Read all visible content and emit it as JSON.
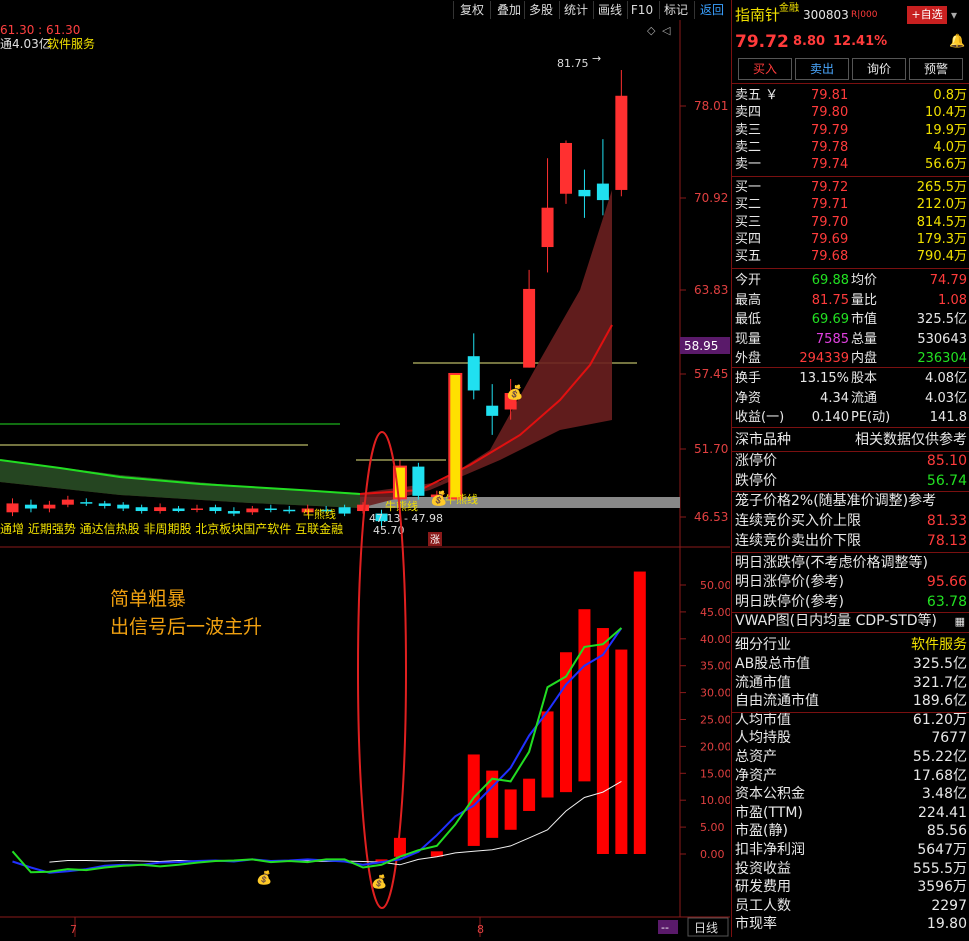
{
  "toolbar": {
    "buttons": [
      "复权",
      "叠加",
      "多股",
      "统计",
      "画线",
      "F10",
      "标记",
      "返回"
    ]
  },
  "chart_header": {
    "line1": "61.30 : 61.30",
    "line2_prefix": "通4.03亿",
    "line2_sector": "软件服务"
  },
  "price_axis": [
    "78.01",
    "70.92",
    "63.83",
    "57.45",
    "51.70",
    "46.53"
  ],
  "current_price_tag": "58.95",
  "high_annotation": "81.75",
  "low_annotation_range": "47.13 - 47.98",
  "low_annotation": "45.70",
  "bull_bear_labels": [
    "牛熊线",
    "牛熊线",
    "牛熊线"
  ],
  "concept_tags": "通增 近期强势 通达信热股 非周期股 北京板块国产软件 互联金融",
  "limit_badge": "涨",
  "annotation_text": [
    "简单粗暴",
    "出信号后一波主升"
  ],
  "indicator_axis": [
    "50.00",
    "45.00",
    "40.00",
    "35.00",
    "30.00",
    "25.00",
    "20.00",
    "15.00",
    "10.00",
    "5.00",
    "0.00"
  ],
  "time_axis": [
    "7",
    "8"
  ],
  "bottom_right": {
    "toggle": "--",
    "label": "日线"
  },
  "stock": {
    "name": "指南针",
    "badge": "金融",
    "code": "300803",
    "r_badge": "R|000",
    "add_button": "+自选",
    "price": "79.72",
    "change": "8.80",
    "change_pct": "12.41%"
  },
  "actions": [
    "买入",
    "卖出",
    "询价",
    "预警"
  ],
  "order_book": {
    "asks": [
      {
        "label": "卖五 ￥",
        "price": "79.81",
        "vol": "0.8万"
      },
      {
        "label": "卖四",
        "price": "79.80",
        "vol": "10.4万"
      },
      {
        "label": "卖三",
        "price": "79.79",
        "vol": "19.9万"
      },
      {
        "label": "卖二",
        "price": "79.78",
        "vol": "4.0万"
      },
      {
        "label": "卖一",
        "price": "79.74",
        "vol": "56.6万"
      }
    ],
    "bids": [
      {
        "label": "买一",
        "price": "79.72",
        "vol": "265.5万"
      },
      {
        "label": "买二",
        "price": "79.71",
        "vol": "212.0万"
      },
      {
        "label": "买三",
        "price": "79.70",
        "vol": "814.5万"
      },
      {
        "label": "买四",
        "price": "79.69",
        "vol": "179.3万"
      },
      {
        "label": "买五",
        "price": "79.68",
        "vol": "790.4万"
      }
    ]
  },
  "stats": [
    {
      "l1": "今开",
      "v1": "69.88",
      "c1": "green",
      "l2": "均价",
      "v2": "74.79",
      "c2": "red"
    },
    {
      "l1": "最高",
      "v1": "81.75",
      "c1": "red",
      "l2": "量比",
      "v2": "1.08",
      "c2": "red"
    },
    {
      "l1": "最低",
      "v1": "69.69",
      "c1": "green",
      "l2": "市值",
      "v2": "325.5亿",
      "c2": "white"
    },
    {
      "l1": "现量",
      "v1": "7585",
      "c1": "magenta",
      "l2": "总量",
      "v2": "530643",
      "c2": "white"
    },
    {
      "l1": "外盘",
      "v1": "294339",
      "c1": "red",
      "l2": "内盘",
      "v2": "236304",
      "c2": "green"
    }
  ],
  "stats2": [
    {
      "l1": "换手",
      "v1": "13.15%",
      "l2": "股本",
      "v2": "4.08亿"
    },
    {
      "l1": "净资",
      "v1": "4.34",
      "l2": "流通",
      "v2": "4.03亿"
    },
    {
      "l1": "收益(一)",
      "v1": "0.140",
      "l2": "PE(动)",
      "v2": "141.8"
    }
  ],
  "market": {
    "left": "深市品种",
    "right": "相关数据仅供参考"
  },
  "limits": [
    {
      "l": "涨停价",
      "v": "85.10",
      "c": "red"
    },
    {
      "l": "跌停价",
      "v": "56.74",
      "c": "green"
    }
  ],
  "cage_title": "笼子价格2%(随基准价调整)参考",
  "cage": [
    {
      "l": "连续竞价买入价上限",
      "v": "81.33"
    },
    {
      "l": "连续竞价卖出价下限",
      "v": "78.13"
    }
  ],
  "tomorrow_title": "明日涨跌停(不考虑价格调整等)",
  "tomorrow": [
    {
      "l": "明日涨停价(参考)",
      "v": "95.66",
      "c": "red"
    },
    {
      "l": "明日跌停价(参考)",
      "v": "63.78",
      "c": "green"
    }
  ],
  "vwap": "VWAP图(日内均量 CDP-STD等)",
  "industry": {
    "label": "细分行业",
    "value": "软件服务"
  },
  "fundamentals": [
    {
      "l": "AB股总市值",
      "v": "325.5亿"
    },
    {
      "l": "流通市值",
      "v": "321.7亿"
    },
    {
      "l": "自由流通市值",
      "v": "189.6亿"
    },
    {
      "l": "人均市值",
      "v": "61.20万"
    },
    {
      "l": "人均持股",
      "v": "7677"
    },
    {
      "l": "总资产",
      "v": "55.22亿"
    },
    {
      "l": "净资产",
      "v": "17.68亿"
    },
    {
      "l": "资本公积金",
      "v": "3.48亿"
    },
    {
      "l": "市盈(TTM)",
      "v": "224.41"
    },
    {
      "l": "市盈(静)",
      "v": "85.56"
    },
    {
      "l": "扣非净利润",
      "v": "5647万"
    },
    {
      "l": "投资收益",
      "v": "555.5万"
    },
    {
      "l": "研发费用",
      "v": "3596万"
    },
    {
      "l": "员工人数",
      "v": "2297"
    },
    {
      "l": "市现率",
      "v": "19.80"
    }
  ],
  "chart_data": {
    "type": "candlestick",
    "price_ylim": [
      46.53,
      81.75
    ],
    "candles": [
      {
        "o": 46.9,
        "c": 47.6,
        "h": 48.0,
        "l": 46.6
      },
      {
        "o": 47.5,
        "c": 47.2,
        "h": 47.9,
        "l": 46.9
      },
      {
        "o": 47.2,
        "c": 47.5,
        "h": 47.8,
        "l": 46.9
      },
      {
        "o": 47.5,
        "c": 47.9,
        "h": 48.2,
        "l": 47.3
      },
      {
        "o": 47.7,
        "c": 47.6,
        "h": 48.0,
        "l": 47.4
      },
      {
        "o": 47.6,
        "c": 47.4,
        "h": 47.8,
        "l": 47.2
      },
      {
        "o": 47.5,
        "c": 47.2,
        "h": 47.7,
        "l": 47.0
      },
      {
        "o": 47.3,
        "c": 47.0,
        "h": 47.5,
        "l": 46.8
      },
      {
        "o": 47.0,
        "c": 47.3,
        "h": 47.6,
        "l": 46.8
      },
      {
        "o": 47.2,
        "c": 47.0,
        "h": 47.4,
        "l": 46.9
      },
      {
        "o": 47.1,
        "c": 47.2,
        "h": 47.5,
        "l": 46.9
      },
      {
        "o": 47.3,
        "c": 47.0,
        "h": 47.5,
        "l": 46.8
      },
      {
        "o": 47.0,
        "c": 46.8,
        "h": 47.3,
        "l": 46.6
      },
      {
        "o": 46.9,
        "c": 47.2,
        "h": 47.4,
        "l": 46.7
      },
      {
        "o": 47.2,
        "c": 47.1,
        "h": 47.5,
        "l": 46.9
      },
      {
        "o": 47.1,
        "c": 47.0,
        "h": 47.4,
        "l": 46.8
      },
      {
        "o": 46.9,
        "c": 47.2,
        "h": 47.5,
        "l": 46.7
      },
      {
        "o": 47.1,
        "c": 47.0,
        "h": 47.4,
        "l": 46.8
      },
      {
        "o": 47.3,
        "c": 46.8,
        "h": 47.5,
        "l": 46.6
      },
      {
        "o": 47.0,
        "c": 47.5,
        "h": 47.7,
        "l": 46.8
      },
      {
        "o": 46.8,
        "c": 46.2,
        "h": 47.1,
        "l": 45.7
      },
      {
        "o": 48.0,
        "c": 50.5,
        "h": 51.0,
        "l": 47.8
      },
      {
        "o": 50.5,
        "c": 48.2,
        "h": 50.8,
        "l": 47.9
      },
      {
        "o": 48.1,
        "c": 48.3,
        "h": 48.6,
        "l": 47.9
      },
      {
        "o": 48.0,
        "c": 57.8,
        "h": 57.8,
        "l": 47.9
      },
      {
        "o": 59.2,
        "c": 56.5,
        "h": 61.0,
        "l": 55.8
      },
      {
        "o": 55.3,
        "c": 54.5,
        "h": 57.0,
        "l": 53.0
      },
      {
        "o": 55.0,
        "c": 56.3,
        "h": 57.4,
        "l": 54.2
      },
      {
        "o": 58.3,
        "c": 64.5,
        "h": 66.0,
        "l": 58.3
      },
      {
        "o": 67.8,
        "c": 70.9,
        "h": 74.8,
        "l": 65.8
      },
      {
        "o": 72.0,
        "c": 76.0,
        "h": 76.2,
        "l": 71.2
      },
      {
        "o": 72.3,
        "c": 71.8,
        "h": 73.9,
        "l": 70.1
      },
      {
        "o": 72.8,
        "c": 71.5,
        "h": 76.3,
        "l": 70.3
      },
      {
        "o": 72.3,
        "c": 79.72,
        "h": 81.75,
        "l": 71.8
      }
    ],
    "indicator_ylim": [
      -5,
      55
    ],
    "indicator_bars": [
      0,
      0,
      0,
      0,
      0,
      0,
      0,
      0,
      0,
      0,
      0,
      0,
      0,
      0,
      0,
      0,
      0,
      0,
      0,
      0,
      -1.5,
      3,
      0,
      -0.5,
      0,
      18.5,
      15.5,
      12,
      14,
      26.5,
      37.5,
      45.5,
      42,
      38,
      52.5
    ],
    "indicator_green_line": [
      0.5,
      -3.4,
      -3.3,
      -2.8,
      -3.0,
      -2.5,
      -2.2,
      -2.0,
      -2.3,
      -2.0,
      -1.6,
      -1.3,
      -1.2,
      -1.0,
      -1.5,
      -1.3,
      -1.5,
      -1.0,
      -1.0,
      -2.5,
      -2.0,
      -0.5,
      0.7,
      1.5,
      5.5,
      10.5,
      14,
      13.5,
      19,
      31,
      33,
      38.5,
      39,
      42
    ],
    "indicator_blue_line": [
      -1.4,
      -2.5,
      -3.5,
      -3.2,
      -2.8,
      -2.2,
      -2.0,
      -2.0,
      -1.6,
      -1.5,
      -1.3,
      -1.2,
      -1.4,
      -1.0,
      -1.3,
      -1.2,
      -1.0,
      -1.2,
      -1.4,
      -2.0,
      -1.5,
      -1.0,
      0.4,
      3.5,
      7,
      9,
      12.5,
      16,
      22,
      26.5,
      31.5,
      35,
      37,
      42
    ],
    "indicator_white_line": [
      -1.5,
      -1.2,
      -1.2,
      -1.3,
      -1.2,
      -1.3,
      -1.4,
      -1.2,
      -1.3,
      -1.2,
      -1.2,
      -1.1,
      -1.3,
      -1.2,
      -1.3,
      -1.4,
      -1.3,
      -1.4,
      -1.5,
      -2.0,
      -1.0,
      -0.5,
      0.2,
      0.5,
      0.8,
      1.5,
      3,
      4.5,
      8,
      10.5,
      11.5,
      13.5
    ]
  }
}
